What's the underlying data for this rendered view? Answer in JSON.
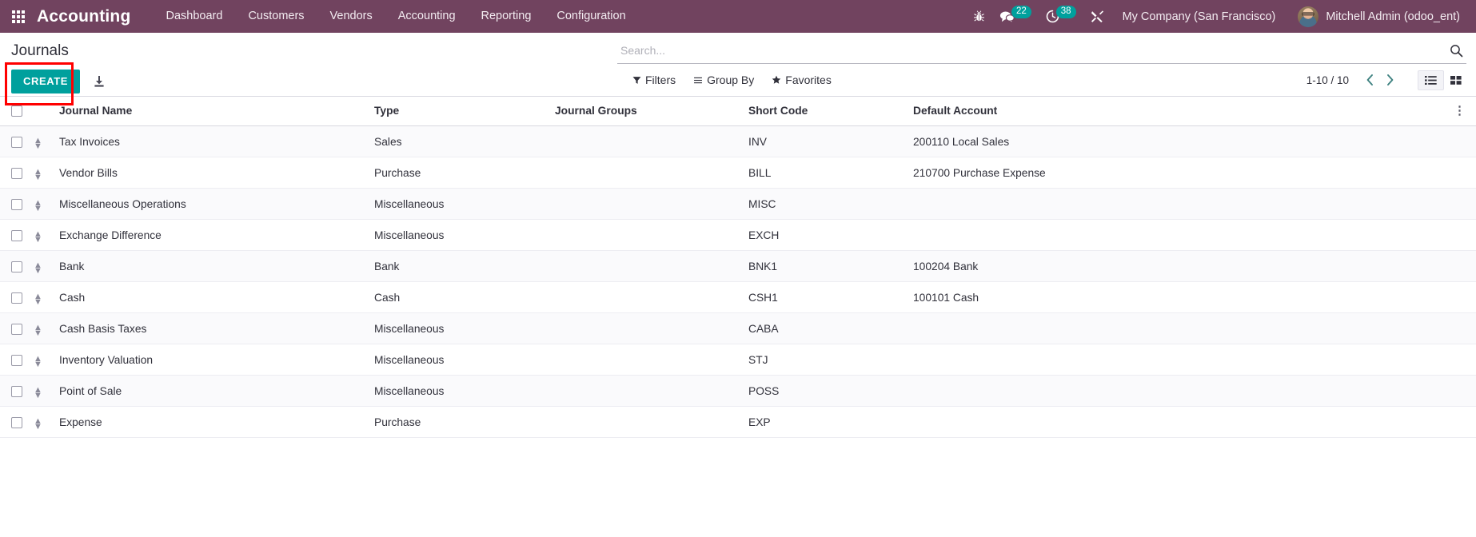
{
  "navbar": {
    "apps_icon": "apps-grid-icon",
    "brand": "Accounting",
    "menu_items": [
      {
        "label": "Dashboard"
      },
      {
        "label": "Customers"
      },
      {
        "label": "Vendors"
      },
      {
        "label": "Accounting"
      },
      {
        "label": "Reporting"
      },
      {
        "label": "Configuration"
      }
    ],
    "sys_icons": [
      {
        "name": "bug-icon",
        "badge": null
      },
      {
        "name": "messages-icon",
        "badge": "22"
      },
      {
        "name": "activities-clock-icon",
        "badge": "38"
      },
      {
        "name": "debug-tools-icon",
        "badge": null
      }
    ],
    "company": "My Company (San Francisco)",
    "user": "Mitchell Admin (odoo_ent)",
    "accent_color": "#71435f",
    "badge_color": "#00A09D"
  },
  "control_panel": {
    "title": "Journals",
    "create_label": "CREATE",
    "create_color": "#00A09D",
    "highlight_color": "#ff0000",
    "import_icon": "import-download-icon",
    "search": {
      "placeholder": "Search...",
      "value": "",
      "icon": "search-icon"
    },
    "filters": [
      {
        "label": "Filters",
        "icon": "funnel-icon"
      },
      {
        "label": "Group By",
        "icon": "hamburger-lines-icon"
      },
      {
        "label": "Favorites",
        "icon": "star-icon"
      }
    ],
    "pager": {
      "count": "1-10 / 10",
      "prev_icon": "chevron-left-icon",
      "next_icon": "chevron-right-icon"
    },
    "views": [
      {
        "name": "list-view",
        "icon": "list-icon",
        "active": true
      },
      {
        "name": "kanban-view",
        "icon": "grid-icon",
        "active": false
      }
    ]
  },
  "table": {
    "columns": [
      "Journal Name",
      "Type",
      "Journal Groups",
      "Short Code",
      "Default Account"
    ],
    "optional_columns_icon": "vertical-dots-icon",
    "rows": [
      {
        "name": "Tax Invoices",
        "type": "Sales",
        "groups": "",
        "code": "INV",
        "account": "200110 Local Sales"
      },
      {
        "name": "Vendor Bills",
        "type": "Purchase",
        "groups": "",
        "code": "BILL",
        "account": "210700 Purchase Expense"
      },
      {
        "name": "Miscellaneous Operations",
        "type": "Miscellaneous",
        "groups": "",
        "code": "MISC",
        "account": ""
      },
      {
        "name": "Exchange Difference",
        "type": "Miscellaneous",
        "groups": "",
        "code": "EXCH",
        "account": ""
      },
      {
        "name": "Bank",
        "type": "Bank",
        "groups": "",
        "code": "BNK1",
        "account": "100204 Bank"
      },
      {
        "name": "Cash",
        "type": "Cash",
        "groups": "",
        "code": "CSH1",
        "account": "100101 Cash"
      },
      {
        "name": "Cash Basis Taxes",
        "type": "Miscellaneous",
        "groups": "",
        "code": "CABA",
        "account": ""
      },
      {
        "name": "Inventory Valuation",
        "type": "Miscellaneous",
        "groups": "",
        "code": "STJ",
        "account": ""
      },
      {
        "name": "Point of Sale",
        "type": "Miscellaneous",
        "groups": "",
        "code": "POSS",
        "account": ""
      },
      {
        "name": "Expense",
        "type": "Purchase",
        "groups": "",
        "code": "EXP",
        "account": ""
      }
    ]
  }
}
